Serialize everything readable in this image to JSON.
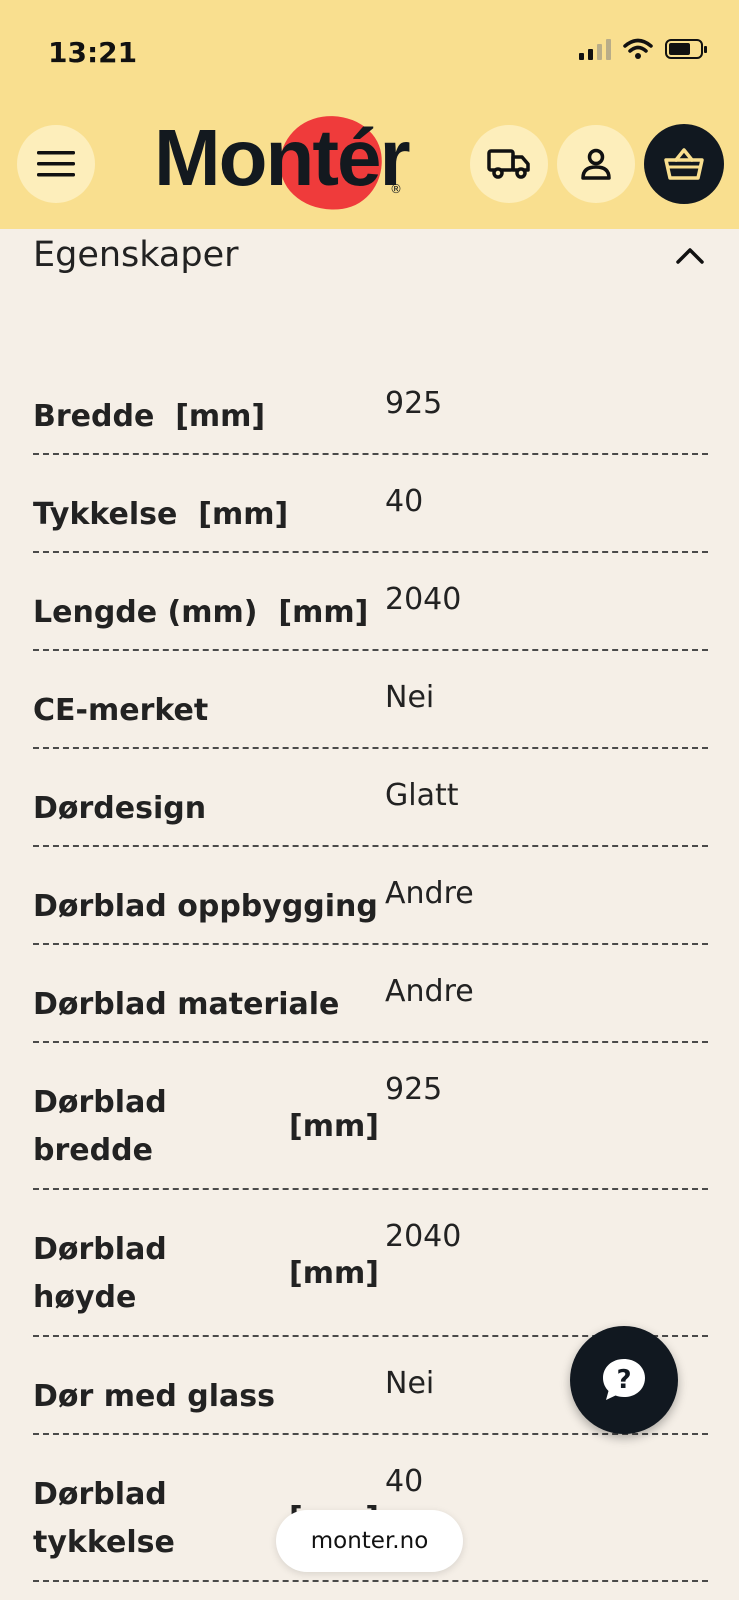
{
  "status_bar": {
    "time": "13:21"
  },
  "header": {
    "logo_text": "Montér",
    "menu_icon": "hamburger-icon",
    "delivery_icon": "truck-icon",
    "account_icon": "user-icon",
    "cart_icon": "basket-icon"
  },
  "section": {
    "title": "Egenskaper",
    "toggle_icon": "chevron-up-icon"
  },
  "properties": [
    {
      "name": "Bredde",
      "unit": "[mm]",
      "value": "925"
    },
    {
      "name": "Tykkelse",
      "unit": "[mm]",
      "value": "40"
    },
    {
      "name": "Lengde (mm)",
      "unit": "[mm]",
      "value": "2040"
    },
    {
      "name": "CE-merket",
      "unit": "",
      "value": "Nei"
    },
    {
      "name": "Dørdesign",
      "unit": "",
      "value": "Glatt"
    },
    {
      "name": "Dørblad oppbygging",
      "unit": "",
      "value": "Andre"
    },
    {
      "name": "Dørblad materiale",
      "unit": "",
      "value": "Andre"
    },
    {
      "name": "Dørblad\nbredde",
      "unit": "[mm]",
      "value": "925"
    },
    {
      "name": "Dørblad\nhøyde",
      "unit": "[mm]",
      "value": "2040"
    },
    {
      "name": "Dør med glass",
      "unit": "",
      "value": "Nei"
    },
    {
      "name": "Dørblad\ntykkelse",
      "unit": "[mm]",
      "value": "40"
    }
  ],
  "help_button": {
    "icon": "question-icon"
  },
  "browser": {
    "url": "monter.no"
  },
  "colors": {
    "header_bg": "#f9df8f",
    "page_bg": "#f5efe7",
    "brand_red": "#ef3b3b",
    "dark": "#111820"
  }
}
